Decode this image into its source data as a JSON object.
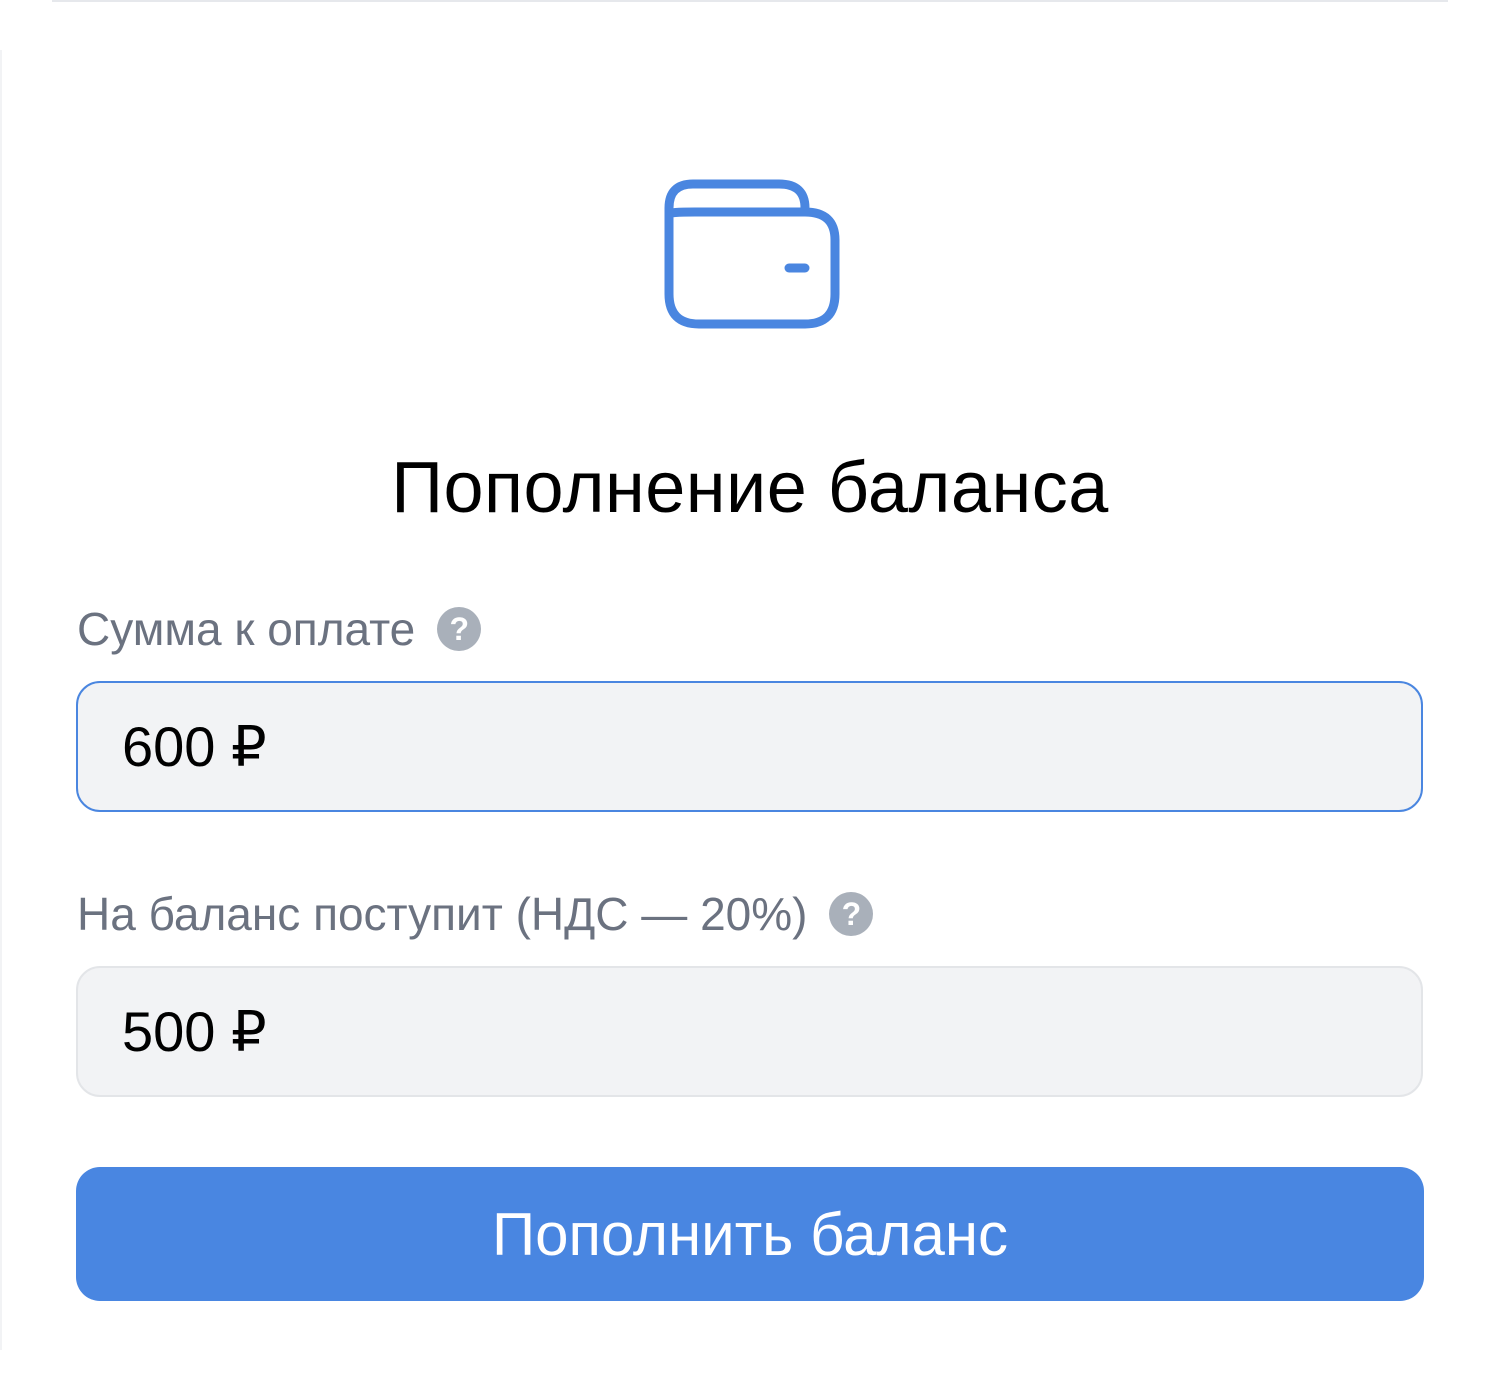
{
  "header": {
    "icon": "wallet-icon",
    "title": "Пополнение баланса"
  },
  "form": {
    "amount_label": "Сумма к оплате",
    "amount_value": "600 ₽",
    "balance_label": "На баланс поступит (НДС — 20%)",
    "balance_value": "500 ₽",
    "help_glyph": "?",
    "submit_label": "Пополнить баланс"
  },
  "colors": {
    "accent": "#4986e1",
    "label": "#6b7280",
    "field_bg": "#f2f3f5",
    "help_icon": "#a9b0ba"
  }
}
